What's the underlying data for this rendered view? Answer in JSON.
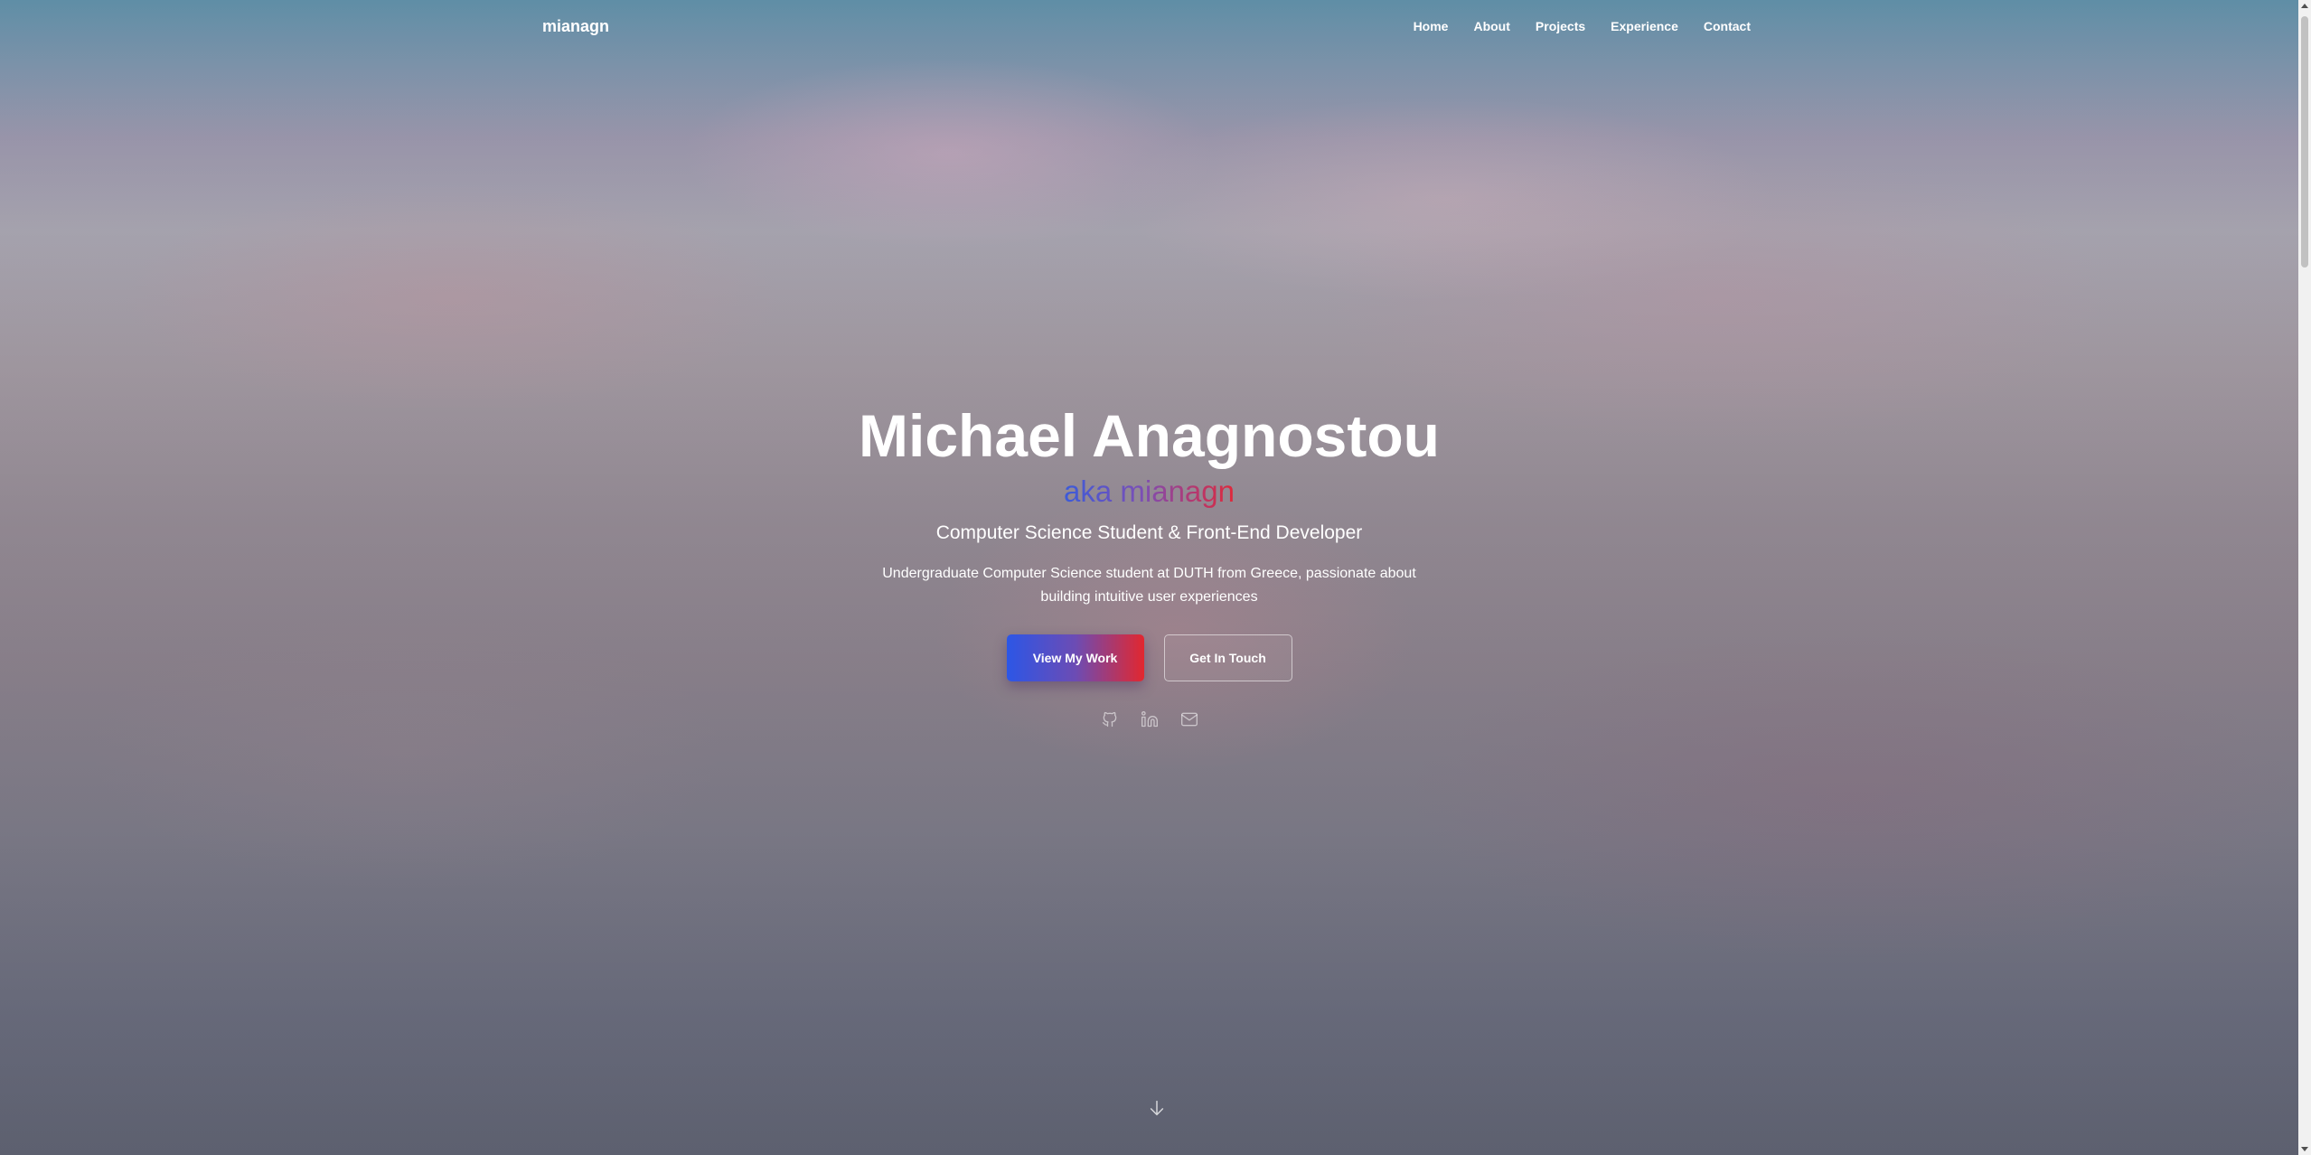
{
  "nav": {
    "logo": "mianagn",
    "links": [
      {
        "label": "Home"
      },
      {
        "label": "About"
      },
      {
        "label": "Projects"
      },
      {
        "label": "Experience"
      },
      {
        "label": "Contact"
      }
    ]
  },
  "hero": {
    "name": "Michael Anagnostou",
    "aka": "aka mianagn",
    "subtitle": "Computer Science Student & Front-End Developer",
    "description": "Undergraduate Computer Science student at DUTH from Greece, passionate about building intuitive user experiences",
    "primary_button": "View My Work",
    "secondary_button": "Get In Touch"
  },
  "socials": [
    {
      "icon": "github-icon"
    },
    {
      "icon": "linkedin-icon"
    },
    {
      "icon": "mail-icon"
    }
  ],
  "scroll_indicator": {
    "icon": "arrow-down-icon"
  },
  "colors": {
    "gradient_start": "#2c56e6",
    "gradient_mid": "#6c4cb4",
    "gradient_end": "#e2272f"
  }
}
